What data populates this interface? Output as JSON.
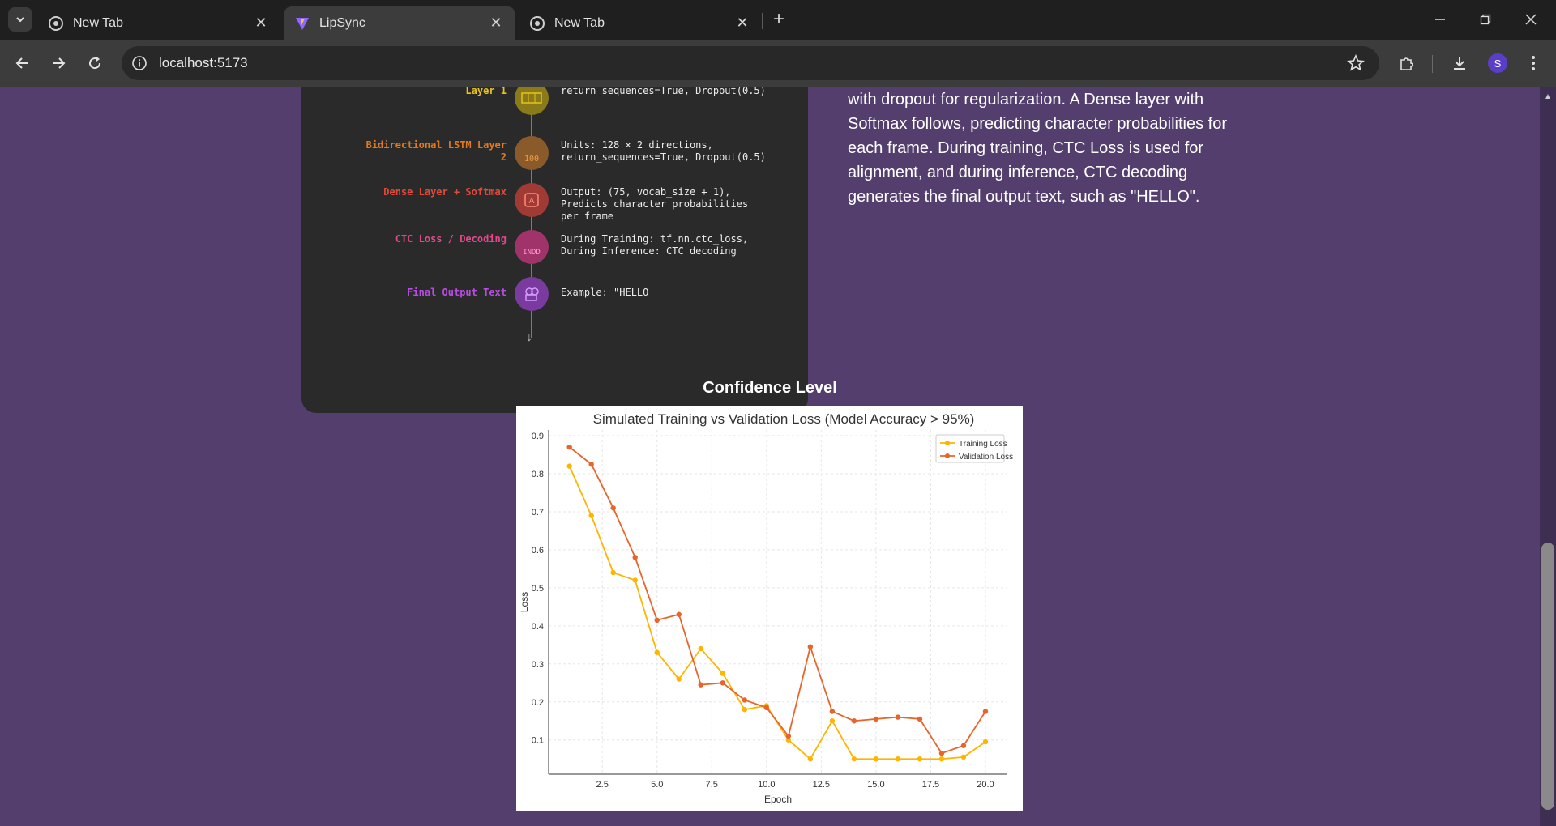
{
  "browser": {
    "tabs": [
      {
        "title": "New Tab",
        "icon": "chrome-icon",
        "active": false
      },
      {
        "title": "LipSync",
        "icon": "vite-icon",
        "active": true
      },
      {
        "title": "New Tab",
        "icon": "chrome-icon",
        "active": false
      }
    ],
    "address": "localhost:5173",
    "profile_initial": "S"
  },
  "architecture": {
    "layers": [
      {
        "name": "Layer 1",
        "description": "return_sequences=True, Dropout(0.5)",
        "color": "#e8c31b"
      },
      {
        "name": "Bidirectional LSTM Layer 2",
        "description": "Units: 128 × 2 directions, return_sequences=True, Dropout(0.5)",
        "color": "#e07a1e",
        "icon_text": "100"
      },
      {
        "name": "Dense Layer + Softmax",
        "description": "Output: (75, vocab_size + 1), Predicts character probabilities per frame",
        "color": "#e04a3a"
      },
      {
        "name": "CTC Loss / Decoding",
        "description": "During Training: tf.nn.ctc_loss, During Inference: CTC decoding",
        "color": "#e04a8c",
        "icon_text": "INDD"
      },
      {
        "name": "Final Output Text",
        "description": "Example: \"HELLO",
        "color": "#b64ee0"
      }
    ]
  },
  "description": "in both directions) to capture temporal dependencies, with dropout for regularization. A Dense layer with Softmax follows, predicting character probabilities for each frame. During training, CTC Loss is used for alignment, and during inference, CTC decoding generates the final output text, such as \"HELLO\".",
  "confidence_heading": "Confidence Level",
  "chart_data": {
    "type": "line",
    "title": "Simulated Training vs Validation Loss (Model Accuracy > 95%)",
    "xlabel": "Epoch",
    "ylabel": "Loss",
    "x": [
      1,
      2,
      3,
      4,
      5,
      6,
      7,
      8,
      9,
      10,
      11,
      12,
      13,
      14,
      15,
      16,
      17,
      18,
      19,
      20
    ],
    "xticks": [
      "2.5",
      "5.0",
      "7.5",
      "10.0",
      "12.5",
      "15.0",
      "17.5",
      "20.0"
    ],
    "yticks": [
      "0.1",
      "0.2",
      "0.3",
      "0.4",
      "0.5",
      "0.6",
      "0.7",
      "0.8",
      "0.9"
    ],
    "xlim": [
      0.05,
      21
    ],
    "ylim": [
      0.01,
      0.915
    ],
    "grid": true,
    "legend": "top-right",
    "series": [
      {
        "name": "Training Loss",
        "color": "#ffb400",
        "values": [
          0.82,
          0.69,
          0.54,
          0.52,
          0.33,
          0.26,
          0.34,
          0.275,
          0.18,
          0.19,
          0.1,
          0.05,
          0.15,
          0.05,
          0.05,
          0.05,
          0.05,
          0.05,
          0.055,
          0.095
        ]
      },
      {
        "name": "Validation Loss",
        "color": "#e8642a",
        "values": [
          0.87,
          0.825,
          0.71,
          0.58,
          0.415,
          0.43,
          0.245,
          0.25,
          0.205,
          0.185,
          0.11,
          0.345,
          0.175,
          0.15,
          0.155,
          0.16,
          0.155,
          0.065,
          0.085,
          0.175
        ]
      }
    ]
  }
}
